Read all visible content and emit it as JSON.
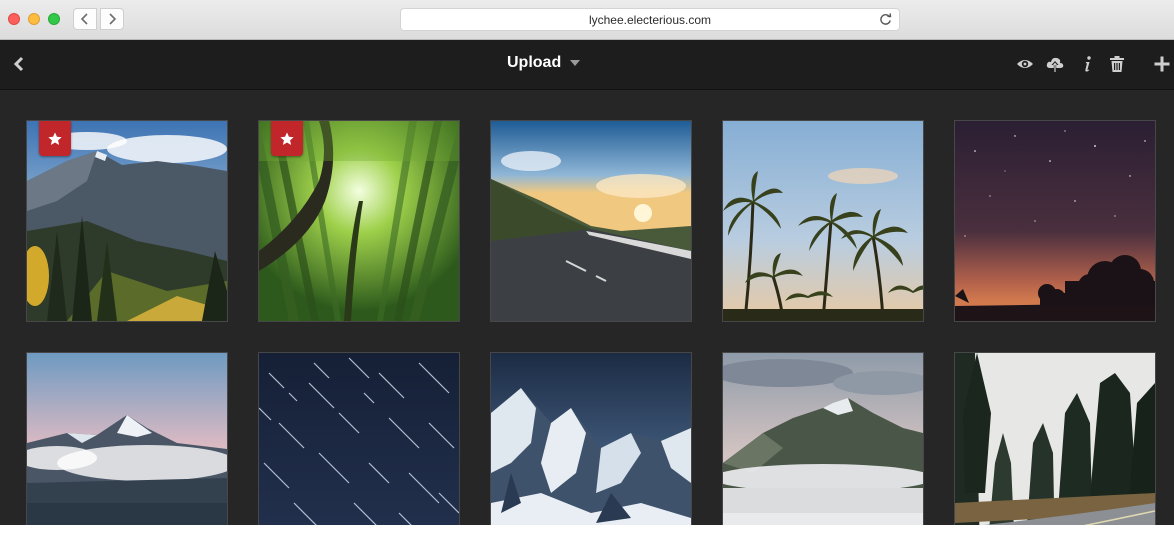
{
  "browser": {
    "url": "lychee.electerious.com",
    "traffic_lights": [
      "close",
      "minimize",
      "zoom"
    ],
    "nav_icons": [
      "chevron-left-icon",
      "chevron-right-icon"
    ],
    "reload_icon": "reload-icon"
  },
  "header": {
    "title": "Upload",
    "back_icon": "chevron-left-icon",
    "dropdown_icon": "caret-down-icon",
    "actions": [
      "eye-icon",
      "cloud-upload-icon",
      "info-icon",
      "trash-icon",
      "plus-icon"
    ]
  },
  "photos": [
    {
      "subject": "mountain-valley",
      "starred": true
    },
    {
      "subject": "bamboo-forest",
      "starred": true
    },
    {
      "subject": "mountain-road-sunset",
      "starred": false
    },
    {
      "subject": "palm-trees",
      "starred": false
    },
    {
      "subject": "starry-night-trees",
      "starred": false
    },
    {
      "subject": "snowy-peak-clouds",
      "starred": false
    },
    {
      "subject": "star-trails",
      "starred": false
    },
    {
      "subject": "snowy-mountains",
      "starred": false
    },
    {
      "subject": "misty-mountain",
      "starred": false
    },
    {
      "subject": "forest-road",
      "starred": false
    }
  ],
  "colors": {
    "header_bg": "#1d1d1d",
    "gallery_bg": "#262626",
    "star_badge": "#c1262b"
  }
}
